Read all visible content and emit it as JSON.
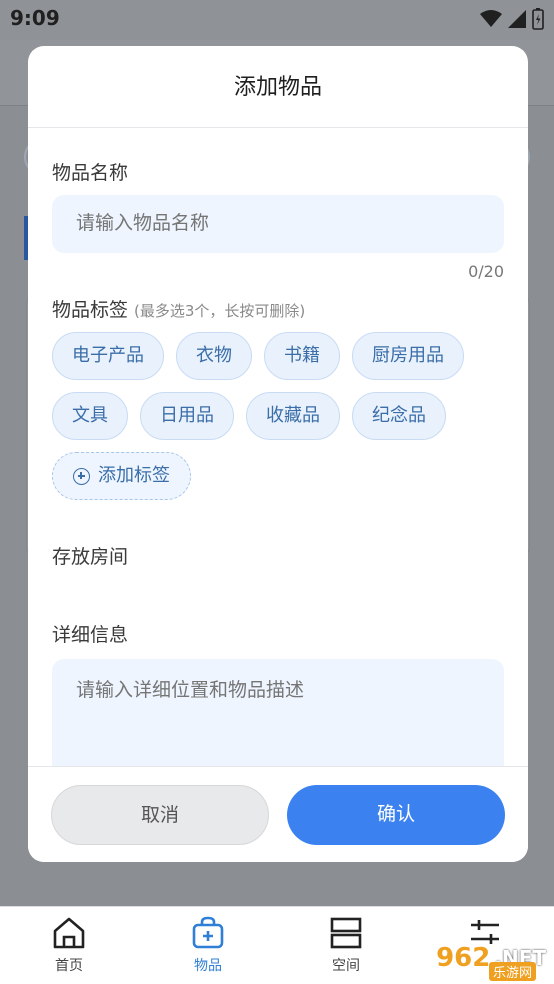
{
  "status_bar": {
    "time": "9:09"
  },
  "dialog": {
    "title": "添加物品",
    "name_section": {
      "label": "物品名称",
      "placeholder": "请输入物品名称",
      "counter": "0/20"
    },
    "tags_section": {
      "label": "物品标签",
      "hint": "(最多选3个，长按可删除)",
      "tags": [
        "电子产品",
        "衣物",
        "书籍",
        "厨房用品",
        "文具",
        "日用品",
        "收藏品",
        "纪念品"
      ],
      "add_tag_label": "添加标签"
    },
    "room_section": {
      "label": "存放房间"
    },
    "detail_section": {
      "label": "详细信息",
      "placeholder": "请输入详细位置和物品描述"
    },
    "cancel_label": "取消",
    "confirm_label": "确认"
  },
  "bottom_nav": {
    "items": [
      {
        "label": "首页",
        "icon": "home-icon",
        "active": false
      },
      {
        "label": "物品",
        "icon": "bag-add-icon",
        "active": true
      },
      {
        "label": "空间",
        "icon": "space-icon",
        "active": false
      }
    ]
  },
  "watermark": {
    "brand": "962",
    "domain": ".NET",
    "sub": "乐游网"
  },
  "colors": {
    "accent": "#3b82f0",
    "tag_text": "#3b6ea8",
    "input_bg": "#eef5ff",
    "active_nav": "#2f7fd6"
  }
}
